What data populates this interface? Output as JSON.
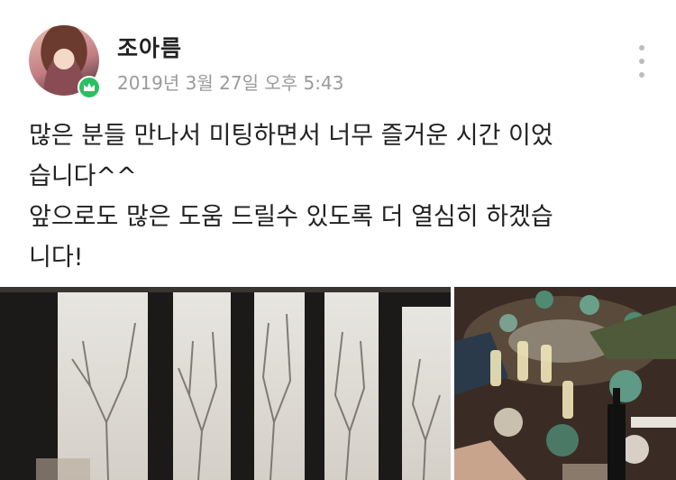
{
  "post": {
    "author_name": "조아름",
    "date": "2019년 3월 27일 오후 5:43",
    "body_lines": [
      "많은 분들 만나서 미팅하면서 너무 즐거운 시간 이었",
      "습니다^^",
      "앞으로도 많은 도움 드릴수 있도록 더 열심히 하겠습",
      "니다!"
    ]
  },
  "icons": {
    "badge": "crown-icon",
    "menu": "more-vertical-icon"
  },
  "colors": {
    "badge_green": "#2bbf63",
    "text_primary": "#222222",
    "text_secondary": "#9a9a9a"
  }
}
